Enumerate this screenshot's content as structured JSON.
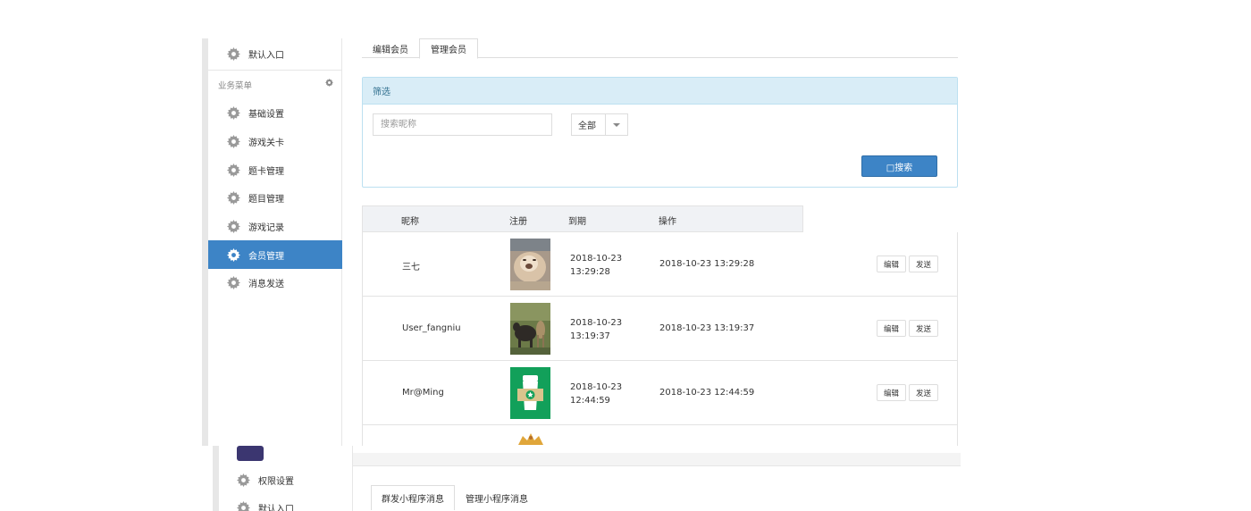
{
  "sidebar": {
    "top_item": "默认入口",
    "section_title": "业务菜单",
    "items": [
      {
        "label": "基础设置"
      },
      {
        "label": "游戏关卡"
      },
      {
        "label": "题卡管理"
      },
      {
        "label": "题目管理"
      },
      {
        "label": "游戏记录"
      },
      {
        "label": "会员管理"
      },
      {
        "label": "消息发送"
      }
    ],
    "active_item": "会员管理"
  },
  "tabs": [
    {
      "label": "编辑会员"
    },
    {
      "label": "管理会员"
    }
  ],
  "active_tab": "管理会员",
  "filter": {
    "title": "筛选",
    "search_placeholder": "搜索昵称",
    "select_value": "全部",
    "search_button": "□搜索"
  },
  "table": {
    "headers": [
      "昵称",
      "注册",
      "到期",
      "操作"
    ],
    "rows": [
      {
        "name": "三七",
        "registered": "2018-10-23 13:29:28",
        "expires": "2018-10-23 13:29:28",
        "avatar": "cat-photo"
      },
      {
        "name": "User_fangniu",
        "registered": "2018-10-23 13:19:37",
        "expires": "2018-10-23 13:19:37",
        "avatar": "cattle-photo"
      },
      {
        "name": "Mr@Ming",
        "registered": "2018-10-23 12:44:59",
        "expires": "2018-10-23 12:44:59",
        "avatar": "green-cup-icon"
      }
    ],
    "row_actions": {
      "edit": "编辑",
      "send": "发送"
    }
  },
  "bottom": {
    "sidebar_items": [
      "权限设置",
      "默认入口"
    ],
    "tabs": [
      "群发小程序消息",
      "管理小程序消息"
    ],
    "active_tab": "群发小程序消息"
  },
  "colors": {
    "primary": "#3d84c6",
    "panel_head_bg": "#d9edf7",
    "panel_head_text": "#31708f",
    "table_head_bg": "#f0f2f5"
  }
}
